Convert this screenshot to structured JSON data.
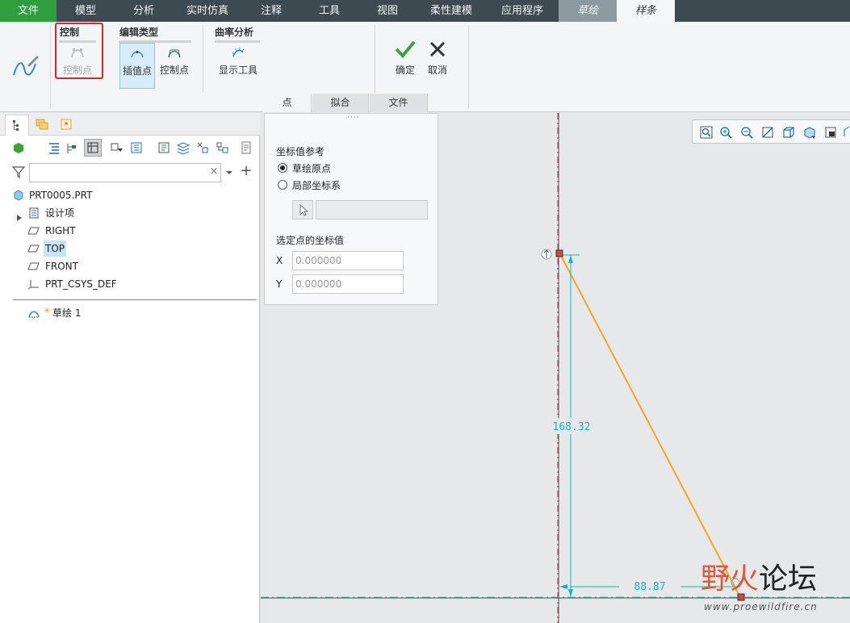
{
  "menu": {
    "items": [
      "文件",
      "模型",
      "分析",
      "实时仿真",
      "注释",
      "工具",
      "视图",
      "柔性建模",
      "应用程序",
      "草绘",
      "样条"
    ]
  },
  "ribbon": {
    "groups": {
      "control": {
        "title": "控制",
        "button": "控制点"
      },
      "edit_type": {
        "title": "编辑类型",
        "interp": "插值点",
        "ctrl": "控制点"
      },
      "curvature": {
        "title": "曲率分析",
        "button": "显示工具"
      }
    },
    "ok_label": "确定",
    "cancel_label": "取消",
    "tabs": [
      "点",
      "拟合",
      "文件"
    ]
  },
  "tree": {
    "filter_placeholder": "",
    "items": {
      "root": "PRT0005.PRT",
      "design_items": "设计项",
      "right": "RIGHT",
      "top": "TOP",
      "front": "FRONT",
      "csys": "PRT_CSYS_DEF",
      "sketch": "草绘 1"
    }
  },
  "points_panel": {
    "coord_ref_label": "坐标值参考",
    "opt_sketch_origin": "草绘原点",
    "opt_local_csys": "局部坐标系",
    "selected_point_label": "选定点的坐标值",
    "x_label": "X",
    "y_label": "Y",
    "x_value": "0.000000",
    "y_value": "0.000000"
  },
  "canvas": {
    "dim_vertical": "168.32",
    "dim_horizontal": "88.87",
    "colors": {
      "spline": "#f5a623",
      "dimension": "#17b3c8",
      "axis_red": "#d04848",
      "axis_cyan": "#3bc4c4"
    }
  },
  "watermark": {
    "brand_a": "野",
    "brand_b": "火",
    "brand_c": "论坛",
    "url": "www.proewildfire.cn"
  }
}
